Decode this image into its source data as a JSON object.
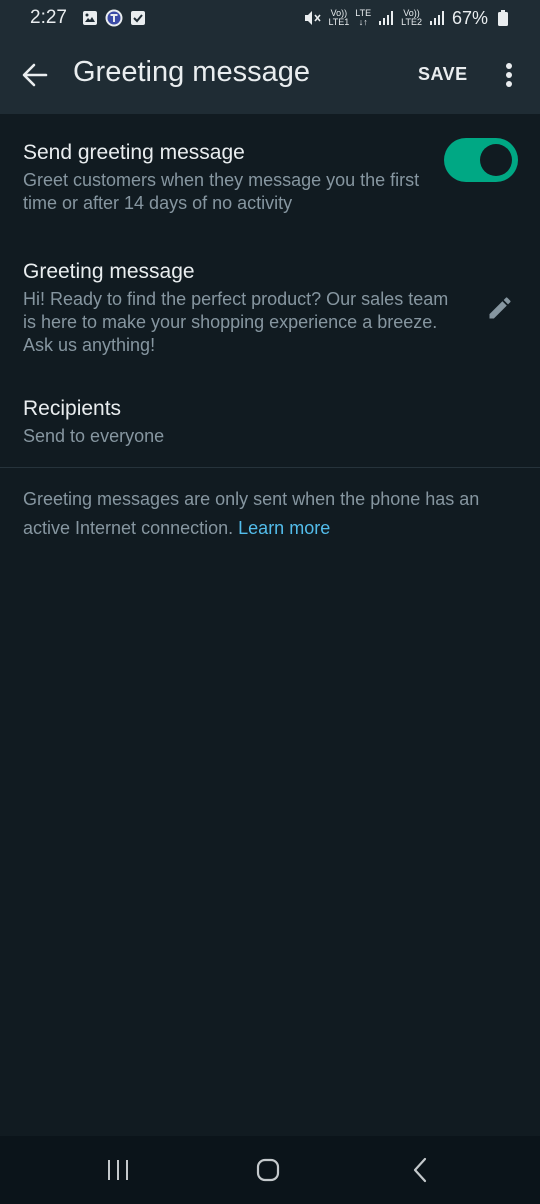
{
  "status_bar": {
    "time": "2:27",
    "net1_top": "Vo))",
    "net1_bottom": "LTE1",
    "lte_top": "LTE",
    "lte_bottom": "↓↑",
    "net2_top": "Vo))",
    "net2_bottom": "LTE2",
    "battery": "67%",
    "icons": [
      "gallery-icon",
      "app-notification-icon",
      "checkbox-icon",
      "mute-icon",
      "signal-icon",
      "signal-icon",
      "battery-icon"
    ]
  },
  "app_bar": {
    "title": "Greeting message",
    "save_label": "SAVE",
    "icons": [
      "back-arrow-icon",
      "more-vert-icon"
    ]
  },
  "settings": {
    "send_greeting": {
      "title": "Send greeting message",
      "subtitle": "Greet customers when they message you the first time or after 14 days of no activity",
      "enabled": true
    },
    "greeting_message": {
      "title": "Greeting message",
      "text": "Hi! Ready to find the perfect product? Our sales team is here to make your shopping experience a breeze. Ask us anything!",
      "icon": "pencil-icon"
    },
    "recipients": {
      "title": "Recipients",
      "value": "Send to everyone"
    }
  },
  "info": {
    "text": "Greeting messages are only sent when the phone has an active Internet connection.",
    "link": "Learn more"
  },
  "colors": {
    "background": "#111b21",
    "bar": "#1f2c34",
    "accent": "#00a884",
    "link": "#53bdeb",
    "secondary_text": "#8696a0"
  }
}
